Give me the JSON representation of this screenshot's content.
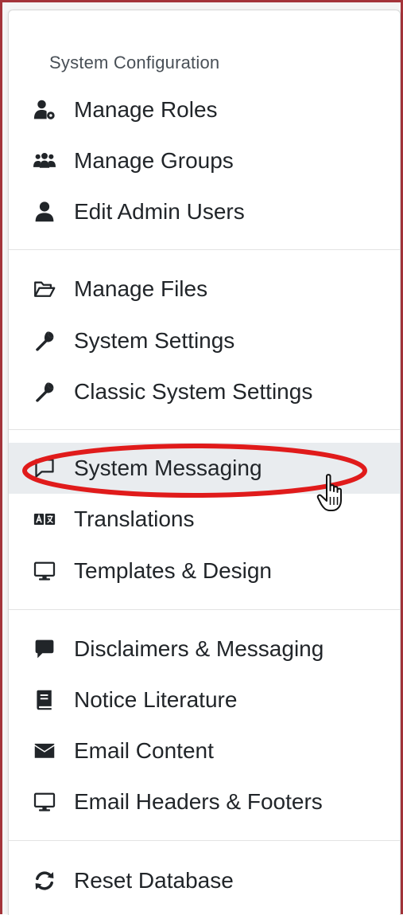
{
  "menu": {
    "section_title": "System Configuration",
    "items": [
      {
        "icon": "users-cog-icon",
        "label": "Manage Roles"
      },
      {
        "icon": "users-group-icon",
        "label": "Manage Groups"
      },
      {
        "icon": "user-icon",
        "label": "Edit Admin Users"
      },
      {
        "icon": "folder-open-icon",
        "label": "Manage Files"
      },
      {
        "icon": "wrench-icon",
        "label": "System Settings"
      },
      {
        "icon": "wrench-icon",
        "label": "Classic System Settings"
      },
      {
        "icon": "comment-outline-icon",
        "label": "System Messaging",
        "highlighted": true
      },
      {
        "icon": "language-icon",
        "label": "Translations"
      },
      {
        "icon": "desktop-icon",
        "label": "Templates & Design"
      },
      {
        "icon": "comment-icon",
        "label": "Disclaimers & Messaging"
      },
      {
        "icon": "book-icon",
        "label": "Notice Literature"
      },
      {
        "icon": "envelope-icon",
        "label": "Email Content"
      },
      {
        "icon": "desktop-icon",
        "label": "Email Headers & Footers"
      },
      {
        "icon": "sync-icon",
        "label": "Reset Database"
      }
    ]
  },
  "colors": {
    "frame_border": "#a4343a",
    "highlight_background": "#e9ecef",
    "annotation_red": "#e01b1b",
    "text": "#212529",
    "section_title": "#495057"
  }
}
